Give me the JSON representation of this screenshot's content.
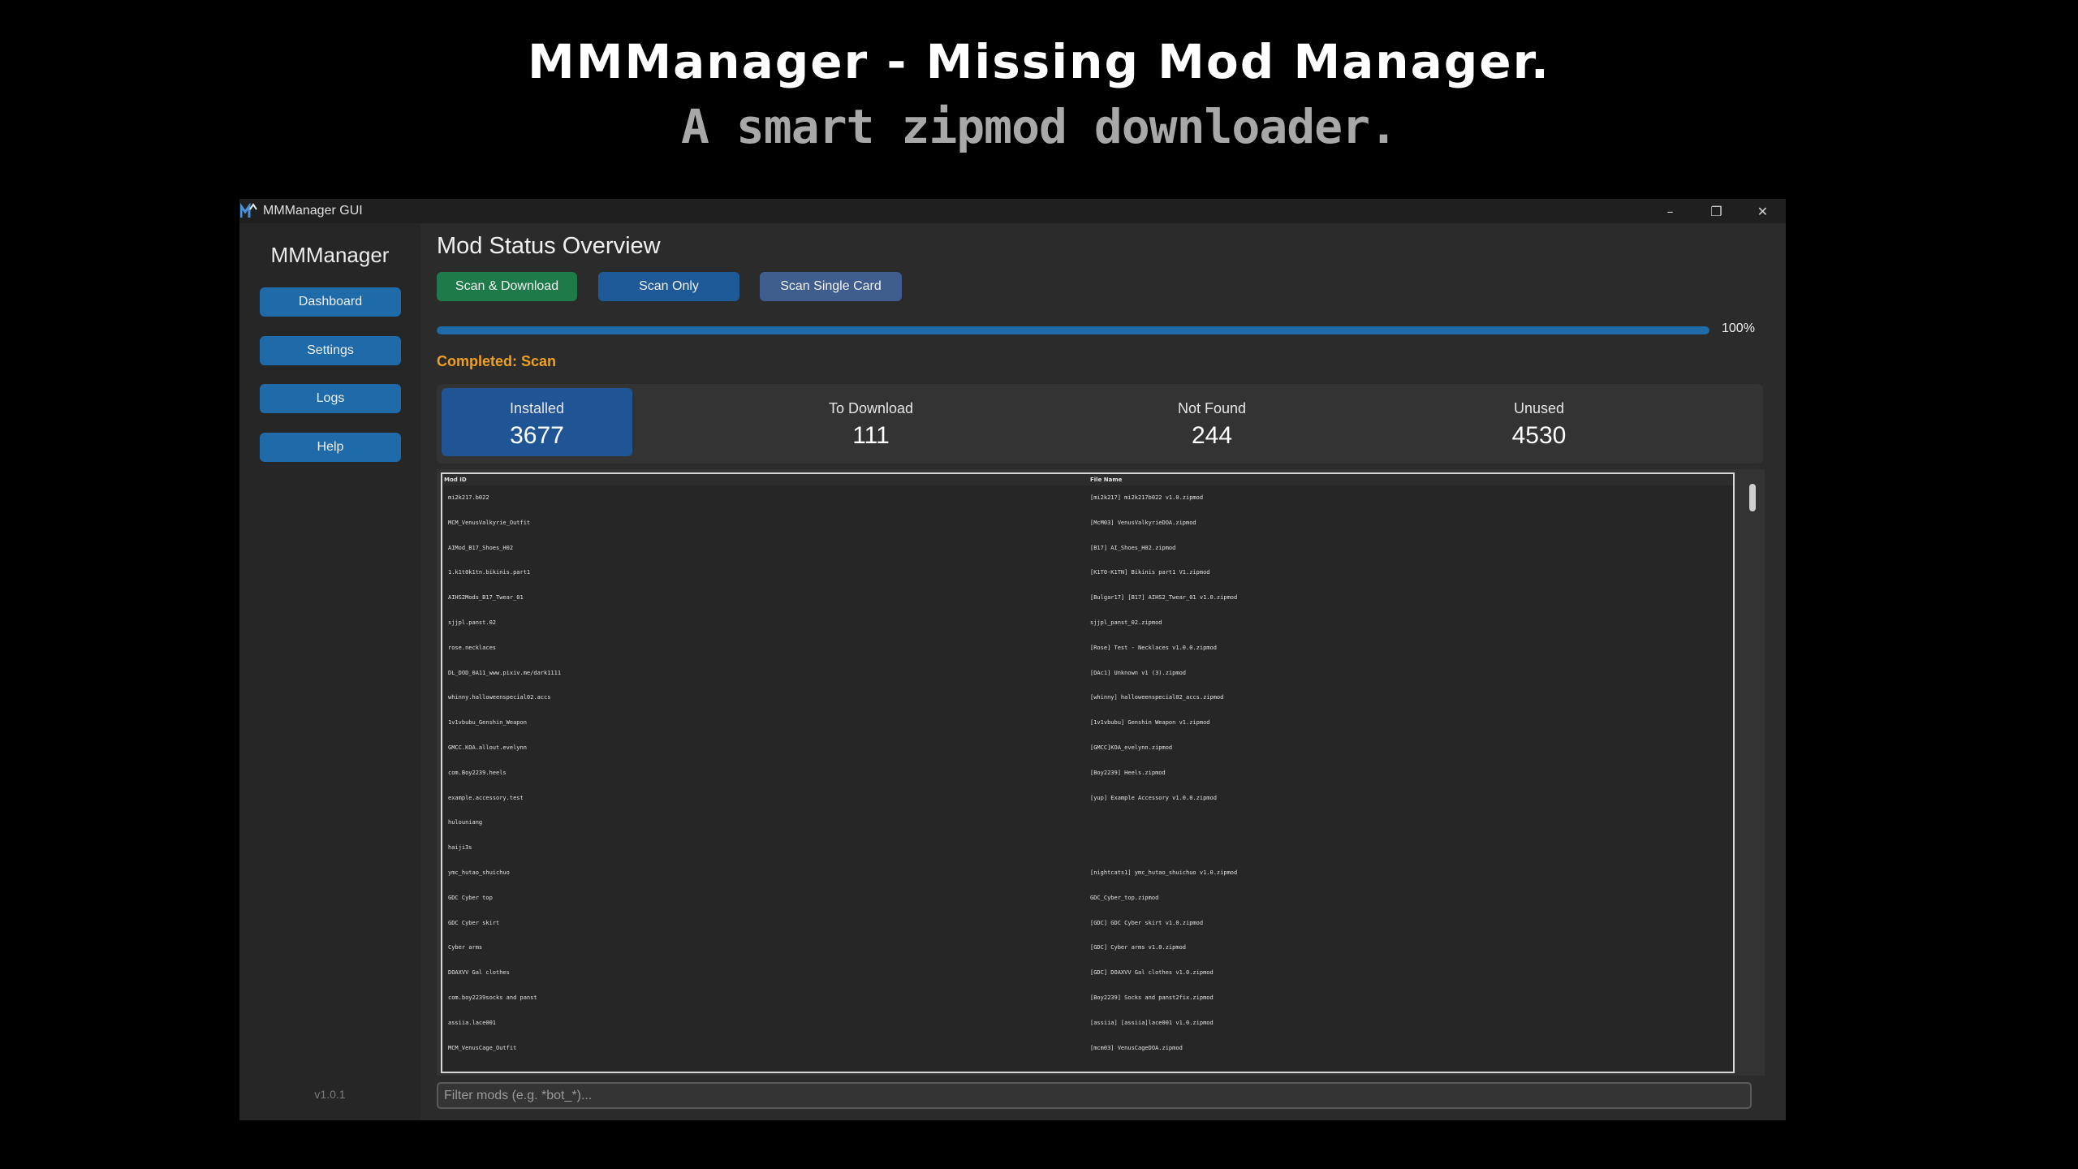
{
  "banner": {
    "title": "MMManager - Missing Mod Manager.",
    "subtitle": "A smart zipmod downloader."
  },
  "window": {
    "title": "MMManager GUI",
    "controls": {
      "minimize": "–",
      "restore": "❐",
      "close": "✕"
    }
  },
  "sidebar": {
    "title": "MMManager",
    "items": [
      {
        "label": "Dashboard"
      },
      {
        "label": "Settings"
      },
      {
        "label": "Logs"
      },
      {
        "label": "Help"
      }
    ],
    "version": "v1.0.1"
  },
  "main": {
    "title": "Mod Status Overview",
    "buttons": {
      "scan_download": "Scan & Download",
      "scan_only": "Scan Only",
      "scan_single": "Scan Single Card"
    },
    "progress": {
      "value": 1.0,
      "label": "100%"
    },
    "status": "Completed: Scan",
    "stats": [
      {
        "label": "Installed",
        "value": "3677",
        "active": true
      },
      {
        "label": "To Download",
        "value": "111",
        "active": false
      },
      {
        "label": "Not Found",
        "value": "244",
        "active": false
      },
      {
        "label": "Unused",
        "value": "4530",
        "active": false
      }
    ],
    "table": {
      "headers": {
        "mod_id": "Mod ID",
        "file_name": "File Name"
      },
      "rows": [
        {
          "mod_id": "mi2k217.b022",
          "file_name": "[mi2k217] mi2k217b022 v1.0.zipmod"
        },
        {
          "mod_id": "MCM_VenusValkyrie_Outfit",
          "file_name": "[McM03] VenusValkyrieDOA.zipmod"
        },
        {
          "mod_id": "AIMod_B17_Shoes_H02",
          "file_name": "[B17] AI_Shoes_H02.zipmod"
        },
        {
          "mod_id": "1.k1t0k1tn.bikinis.part1",
          "file_name": "[K1T0-K1TN] Bikinis part1 V1.zipmod"
        },
        {
          "mod_id": "AIHS2Mods_B17_Twear_01",
          "file_name": "[Bulgar17] [B17] AIHS2_Twear_01 v1.0.zipmod"
        },
        {
          "mod_id": "sjjpl.panst.02",
          "file_name": "sjjpl_panst_02.zipmod"
        },
        {
          "mod_id": "rose.necklaces",
          "file_name": "[Rose] Test - Necklaces v1.0.0.zipmod"
        },
        {
          "mod_id": "DL_DOD_0A11_www.pixiv.me/dark1111",
          "file_name": "[DAc1] Unknown v1 (3).zipmod"
        },
        {
          "mod_id": "whinny.halloweenspecial02.accs",
          "file_name": "[whinny] halloweenspecial02_accs.zipmod"
        },
        {
          "mod_id": "1v1vbubu_Genshin_Weapon",
          "file_name": "[1v1vbubu] Genshin Weapon v1.zipmod"
        },
        {
          "mod_id": "GMCC.KOA.allout.evelynn",
          "file_name": "[GMCC]KOA_evelynn.zipmod"
        },
        {
          "mod_id": "com.Boy2239.heels",
          "file_name": "[Boy2239] Heels.zipmod"
        },
        {
          "mod_id": "example.accessory.test",
          "file_name": "[yup] Example Accessory v1.0.0.zipmod"
        },
        {
          "mod_id": "hulouniang",
          "file_name": ""
        },
        {
          "mod_id": "haiji3s",
          "file_name": ""
        },
        {
          "mod_id": "ymc_hutao_shuichuo",
          "file_name": "[nightcats1] ymc_hutao_shuichuo v1.0.zipmod"
        },
        {
          "mod_id": "GDC Cyber top",
          "file_name": "GDC_Cyber_top.zipmod"
        },
        {
          "mod_id": "GDC Cyber skirt",
          "file_name": "[GDC] GDC Cyber skirt v1.0.zipmod"
        },
        {
          "mod_id": "Cyber arms",
          "file_name": "[GDC] Cyber arms v1.0.zipmod"
        },
        {
          "mod_id": "DOAXVV Gal clothes",
          "file_name": "[GDC] DOAXVV Gal clothes v1.0.zipmod"
        },
        {
          "mod_id": "com.boy2239socks and panst",
          "file_name": "[Boy2239] Socks and panst2fix.zipmod"
        },
        {
          "mod_id": "assiia.lace001",
          "file_name": "[assiia] [assiia]lace001 v1.0.zipmod"
        },
        {
          "mod_id": "MCM_VenusCage_Outfit",
          "file_name": "[mcm03] VenusCageDOA.zipmod"
        }
      ]
    },
    "filter": {
      "value": "",
      "placeholder": "Filter mods (e.g. *bot_*)..."
    }
  },
  "colors": {
    "accent": "#1f6aa8",
    "green_button": "#1f7a4a",
    "status": "#f0a020",
    "active_stat": "#1f5594"
  },
  "icons": [
    "app-logo-icon",
    "minimize-icon",
    "restore-icon",
    "close-icon"
  ]
}
